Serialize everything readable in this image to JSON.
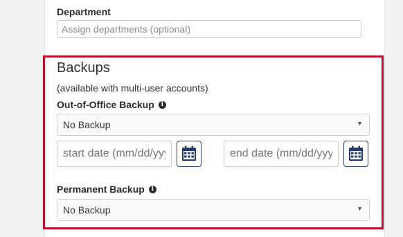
{
  "department": {
    "label": "Department",
    "placeholder": "Assign departments (optional)"
  },
  "backups": {
    "title": "Backups",
    "subtitle": "(available with multi-user accounts)",
    "out_of_office": {
      "label": "Out-of-Office Backup",
      "selected": "No Backup",
      "start_placeholder": "start date (mm/dd/yyyy)",
      "end_placeholder": "end date (mm/dd/yyyy)"
    },
    "permanent": {
      "label": "Permanent Backup",
      "selected": "No Backup"
    }
  },
  "colors": {
    "highlight_border": "#c0102d",
    "calendar_accent": "#1f3a73"
  },
  "icons": {
    "info": "info-icon",
    "calendar": "calendar-icon",
    "caret": "caret-down-icon"
  }
}
